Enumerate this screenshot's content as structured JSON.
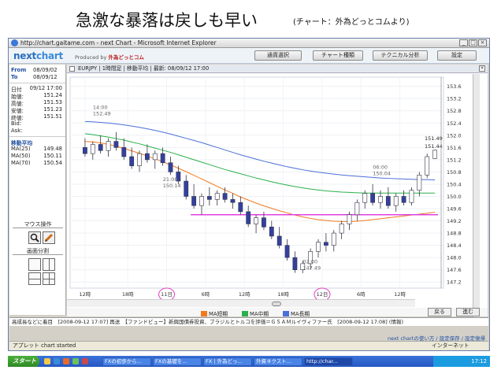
{
  "slide": {
    "title": "急激な暴落は戻しも早い",
    "subtitle": "(チャート：外為どっとコムより)"
  },
  "window": {
    "title": "http://chart.gaitame.com - next Chart - Microsoft Internet Explorer",
    "controls": {
      "minimize": "_",
      "maximize": "□",
      "close": "×"
    }
  },
  "app": {
    "logo_part1": "next",
    "logo_part2": "chart",
    "produced_by": "Produced by",
    "brand": "外為どっとコム",
    "buttons": [
      "通貨選択",
      "チャート種類",
      "テクニカル分析",
      "設定"
    ]
  },
  "info": {
    "from_label": "From",
    "from_value": "08/09/02",
    "to_label": "To",
    "to_value": "08/09/12",
    "rows": [
      {
        "k": "日付",
        "v": "09/12 17:00"
      },
      {
        "k": "始値:",
        "v": "151.24"
      },
      {
        "k": "高値:",
        "v": "151.53"
      },
      {
        "k": "安値:",
        "v": "151.23"
      },
      {
        "k": "終値:",
        "v": "151.51"
      },
      {
        "k": "Bid:",
        "v": ""
      },
      {
        "k": "Ask:",
        "v": ""
      }
    ],
    "ma_title": "移動平均",
    "ma_rows": [
      {
        "k": "MA(25)",
        "v": "149.48"
      },
      {
        "k": "MA(50)",
        "v": "150.11"
      },
      {
        "k": "MA(70)",
        "v": "150.54"
      }
    ]
  },
  "tools": {
    "mouse_title": "マウス操作",
    "zoom_icon": "magnifier-icon",
    "draw_icon": "pencil-icon",
    "split_title": "画面分割"
  },
  "chart_header": {
    "text": "EURJPY | 1時間足 | 移動平均 | 最新: 08/09/12 17:00",
    "close": "×"
  },
  "chart_data": {
    "type": "candlestick",
    "symbol": "EURJPY",
    "ylim": [
      147.0,
      153.9
    ],
    "y_ticks": [
      153.6,
      153.2,
      152.8,
      152.4,
      152.0,
      151.6,
      151.2,
      150.8,
      150.4,
      150.0,
      149.6,
      149.2,
      148.8,
      148.4,
      148.0,
      147.6,
      147.2
    ],
    "x_tick_labels": [
      "12時",
      "18時",
      "11日",
      "6時",
      "12時",
      "18時",
      "12日",
      "6時",
      "12時"
    ],
    "highlighted_x_labels": [
      "11日",
      "12日"
    ],
    "annotations": [
      {
        "text": "14:00",
        "value": "152.49"
      },
      {
        "text": "21:00",
        "value": "150.14"
      },
      {
        "text": "02:00",
        "value": "147.49"
      },
      {
        "text": "06:00",
        "value": "150.04"
      }
    ],
    "price_marks": [
      "151.49",
      "151.44"
    ],
    "support_line": 149.4,
    "candles": [
      {
        "o": 151.6,
        "h": 151.9,
        "l": 151.3,
        "c": 151.4
      },
      {
        "o": 151.4,
        "h": 151.8,
        "l": 151.2,
        "c": 151.7
      },
      {
        "o": 151.7,
        "h": 152.0,
        "l": 151.4,
        "c": 151.5
      },
      {
        "o": 151.5,
        "h": 151.9,
        "l": 151.3,
        "c": 151.8
      },
      {
        "o": 151.8,
        "h": 152.1,
        "l": 151.5,
        "c": 151.6
      },
      {
        "o": 151.6,
        "h": 151.9,
        "l": 151.2,
        "c": 151.3
      },
      {
        "o": 151.3,
        "h": 151.6,
        "l": 150.9,
        "c": 151.0
      },
      {
        "o": 151.0,
        "h": 151.5,
        "l": 150.8,
        "c": 151.4
      },
      {
        "o": 151.4,
        "h": 151.7,
        "l": 151.1,
        "c": 151.2
      },
      {
        "o": 151.2,
        "h": 151.5,
        "l": 150.9,
        "c": 151.4
      },
      {
        "o": 151.4,
        "h": 151.6,
        "l": 151.0,
        "c": 151.1
      },
      {
        "o": 151.1,
        "h": 151.3,
        "l": 150.7,
        "c": 150.8
      },
      {
        "o": 150.8,
        "h": 151.0,
        "l": 150.4,
        "c": 150.5
      },
      {
        "o": 150.5,
        "h": 150.7,
        "l": 149.9,
        "c": 150.0
      },
      {
        "o": 150.0,
        "h": 150.4,
        "l": 149.6,
        "c": 149.7
      },
      {
        "o": 149.7,
        "h": 150.1,
        "l": 149.4,
        "c": 150.0
      },
      {
        "o": 150.0,
        "h": 150.3,
        "l": 149.7,
        "c": 149.9
      },
      {
        "o": 149.9,
        "h": 150.2,
        "l": 149.7,
        "c": 150.1
      },
      {
        "o": 150.1,
        "h": 150.3,
        "l": 149.8,
        "c": 149.9
      },
      {
        "o": 149.9,
        "h": 150.1,
        "l": 149.6,
        "c": 149.8
      },
      {
        "o": 149.8,
        "h": 150.0,
        "l": 149.4,
        "c": 149.5
      },
      {
        "o": 149.5,
        "h": 149.7,
        "l": 149.0,
        "c": 149.1
      },
      {
        "o": 149.1,
        "h": 149.4,
        "l": 148.8,
        "c": 149.3
      },
      {
        "o": 149.3,
        "h": 149.5,
        "l": 148.9,
        "c": 149.0
      },
      {
        "o": 149.0,
        "h": 149.2,
        "l": 148.6,
        "c": 148.7
      },
      {
        "o": 148.7,
        "h": 149.0,
        "l": 148.3,
        "c": 148.4
      },
      {
        "o": 148.4,
        "h": 148.6,
        "l": 147.9,
        "c": 148.0
      },
      {
        "o": 148.0,
        "h": 148.2,
        "l": 147.5,
        "c": 147.6
      },
      {
        "o": 147.6,
        "h": 147.9,
        "l": 147.49,
        "c": 147.8
      },
      {
        "o": 147.8,
        "h": 148.3,
        "l": 147.6,
        "c": 148.2
      },
      {
        "o": 148.2,
        "h": 148.6,
        "l": 148.0,
        "c": 148.5
      },
      {
        "o": 148.5,
        "h": 148.8,
        "l": 148.2,
        "c": 148.4
      },
      {
        "o": 148.4,
        "h": 148.9,
        "l": 148.2,
        "c": 148.8
      },
      {
        "o": 148.8,
        "h": 149.2,
        "l": 148.6,
        "c": 149.1
      },
      {
        "o": 149.1,
        "h": 149.5,
        "l": 148.9,
        "c": 149.4
      },
      {
        "o": 149.4,
        "h": 149.9,
        "l": 149.2,
        "c": 149.8
      },
      {
        "o": 149.8,
        "h": 150.2,
        "l": 149.6,
        "c": 150.1
      },
      {
        "o": 150.1,
        "h": 150.4,
        "l": 149.7,
        "c": 149.8
      },
      {
        "o": 149.8,
        "h": 150.2,
        "l": 149.6,
        "c": 150.0
      },
      {
        "o": 150.0,
        "h": 150.3,
        "l": 149.6,
        "c": 149.7
      },
      {
        "o": 149.7,
        "h": 150.1,
        "l": 149.5,
        "c": 150.0
      },
      {
        "o": 150.0,
        "h": 150.2,
        "l": 149.7,
        "c": 149.8
      },
      {
        "o": 149.8,
        "h": 150.3,
        "l": 149.7,
        "c": 150.2
      },
      {
        "o": 150.2,
        "h": 150.8,
        "l": 150.0,
        "c": 150.7
      },
      {
        "o": 150.7,
        "h": 151.4,
        "l": 150.6,
        "c": 151.3
      },
      {
        "o": 151.24,
        "h": 151.53,
        "l": 151.23,
        "c": 151.51
      }
    ],
    "ma_lines": [
      {
        "name": "MA短期",
        "color": "#f07a1e",
        "values": [
          151.8,
          151.78,
          151.75,
          151.7,
          151.64,
          151.57,
          151.49,
          151.41,
          151.32,
          151.23,
          151.13,
          151.03,
          150.92,
          150.81,
          150.69,
          150.57,
          150.45,
          150.33,
          150.21,
          150.1,
          149.98,
          149.88,
          149.78,
          149.69,
          149.61,
          149.53,
          149.46,
          149.39,
          149.33,
          149.28,
          149.24,
          149.21,
          149.19,
          149.18,
          149.18,
          149.19,
          149.21,
          149.24,
          149.27,
          149.3,
          149.33,
          149.36,
          149.39,
          149.42,
          149.45,
          149.48
        ]
      },
      {
        "name": "MA中期",
        "color": "#2ab04a",
        "values": [
          152.05,
          152.02,
          151.98,
          151.94,
          151.89,
          151.84,
          151.78,
          151.72,
          151.65,
          151.58,
          151.51,
          151.44,
          151.36,
          151.28,
          151.2,
          151.12,
          151.04,
          150.96,
          150.88,
          150.81,
          150.74,
          150.67,
          150.6,
          150.54,
          150.48,
          150.42,
          150.37,
          150.32,
          150.28,
          150.24,
          150.21,
          150.18,
          150.16,
          150.14,
          150.13,
          150.12,
          150.11,
          150.11,
          150.11,
          150.11,
          150.11,
          150.11,
          150.11,
          150.11,
          150.11,
          150.11
        ]
      },
      {
        "name": "MA長期",
        "color": "#4a6fd8",
        "values": [
          152.45,
          152.44,
          152.42,
          152.4,
          152.37,
          152.34,
          152.3,
          152.26,
          152.21,
          152.16,
          152.1,
          152.04,
          151.97,
          151.9,
          151.83,
          151.76,
          151.68,
          151.6,
          151.52,
          151.44,
          151.36,
          151.29,
          151.22,
          151.15,
          151.09,
          151.03,
          150.97,
          150.92,
          150.87,
          150.83,
          150.79,
          150.76,
          150.73,
          150.7,
          150.68,
          150.66,
          150.64,
          150.62,
          150.6,
          150.59,
          150.58,
          150.57,
          150.56,
          150.55,
          150.55,
          150.54
        ]
      }
    ]
  },
  "legend": [
    {
      "label": "MA短期",
      "color": "#f07a1e"
    },
    {
      "label": "MA中期",
      "color": "#2ab04a"
    },
    {
      "label": "MA長期",
      "color": "#4a6fd8"
    }
  ],
  "nav_buttons": {
    "back": "戻る",
    "forward": "進む"
  },
  "ticker": {
    "text": "高成長などに着目　[2008-09-12 17:07] 再送　【ファンドビュー】新興国債券投資、ブラジルとトルコを評価＝ＧＳＡＭルイヴィファー氏　[2008-09-12 17:08] (情報)",
    "help": "next chartの使い方 / 設定保存 / 設定復帰"
  },
  "statusbar": {
    "text": "アプレット chart started",
    "zone": "インターネット"
  },
  "taskbar": {
    "start": "スタート",
    "tasks": [
      "FXの初歩から...",
      "FXの基礎を...",
      "FX | 外為どっ...",
      "外資ネクスト...",
      "http://char..."
    ],
    "clock": "17:12"
  }
}
